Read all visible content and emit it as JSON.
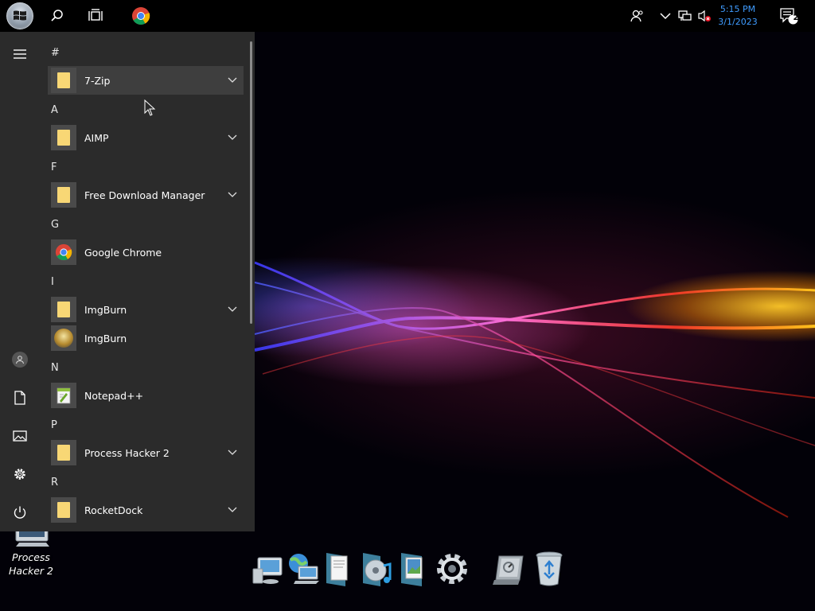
{
  "taskbar": {
    "clock_time": "5:15 PM",
    "clock_date": "3/1/2023",
    "notification_count": "2"
  },
  "start_menu": {
    "groups": [
      {
        "letter": "#",
        "apps": [
          {
            "label": "7-Zip",
            "icon": "folder-icon",
            "expandable": true
          }
        ]
      },
      {
        "letter": "A",
        "apps": [
          {
            "label": "AIMP",
            "icon": "folder-icon",
            "expandable": true
          }
        ]
      },
      {
        "letter": "F",
        "apps": [
          {
            "label": "Free Download Manager",
            "icon": "folder-icon",
            "expandable": true
          }
        ]
      },
      {
        "letter": "G",
        "apps": [
          {
            "label": "Google Chrome",
            "icon": "chrome-icon",
            "expandable": false
          }
        ]
      },
      {
        "letter": "I",
        "apps": [
          {
            "label": "ImgBurn",
            "icon": "folder-icon",
            "expandable": true
          },
          {
            "label": "ImgBurn",
            "icon": "imgburn-icon",
            "expandable": false
          }
        ]
      },
      {
        "letter": "N",
        "apps": [
          {
            "label": "Notepad++",
            "icon": "notepad-plus-plus-icon",
            "expandable": false
          }
        ]
      },
      {
        "letter": "P",
        "apps": [
          {
            "label": "Process Hacker 2",
            "icon": "folder-icon",
            "expandable": true
          }
        ]
      },
      {
        "letter": "R",
        "apps": [
          {
            "label": "RocketDock",
            "icon": "folder-icon",
            "expandable": true
          }
        ]
      }
    ]
  },
  "desktop": {
    "icon_label_line1": "Process",
    "icon_label_line2": "Hacker 2"
  },
  "colors": {
    "menu_bg": "#2b2b2b",
    "hover_bg": "#3e3e3e",
    "clock_blue": "#3f9cff",
    "folder_yellow": "#f8d775"
  }
}
